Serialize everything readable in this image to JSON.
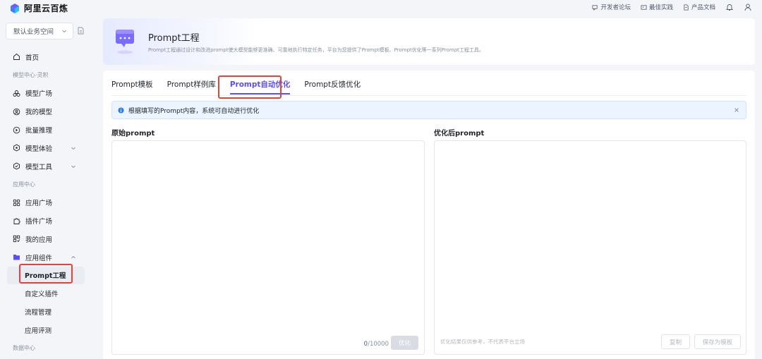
{
  "brand": {
    "name": "阿里云百炼"
  },
  "topbar": {
    "links": [
      {
        "label": "开发者论坛",
        "icon": "forum-icon"
      },
      {
        "label": "最佳实践",
        "icon": "image-icon"
      },
      {
        "label": "产品文档",
        "icon": "document-icon"
      }
    ],
    "icons": [
      "bell-icon",
      "user-icon"
    ]
  },
  "sidebar": {
    "workspace": "默认业务空间",
    "home": "首页",
    "section_model": "模型中心·灵积",
    "model_items": [
      "模型广场",
      "我的模型",
      "批量推理",
      "模型体验",
      "模型工具"
    ],
    "section_app": "应用中心",
    "app_items": [
      "应用广场",
      "插件广场",
      "我的应用",
      "应用组件"
    ],
    "component_items": [
      "Prompt工程",
      "自定义插件",
      "流程管理",
      "应用评测"
    ],
    "section_data": "数据中心"
  },
  "header": {
    "title": "Prompt工程",
    "desc": "Prompt工程通过设计和改进prompt使大模型能够更准确、可靠地执行特定任务，平台为您提供了Prompt模板、Prompt优化等一系列Prompt工程工具。"
  },
  "tabs": [
    "Prompt模板",
    "Prompt样例库",
    "Prompt自动优化",
    "Prompt反馈优化"
  ],
  "active_tab": 2,
  "notice": "根据填写的Prompt内容，系统可自动进行优化",
  "left_panel": {
    "label": "原始prompt",
    "counter_current": "0",
    "counter_max": "/10000",
    "button": "优化"
  },
  "right_panel": {
    "label": "优化后prompt",
    "hint": "优化结果仅供参考，不代表平台立场",
    "copy_button": "复制",
    "save_button": "保存为模板"
  },
  "colors": {
    "accent": "#5b4ef5",
    "highlight": "#e5433a",
    "notice_bg": "#ecf4ff"
  }
}
